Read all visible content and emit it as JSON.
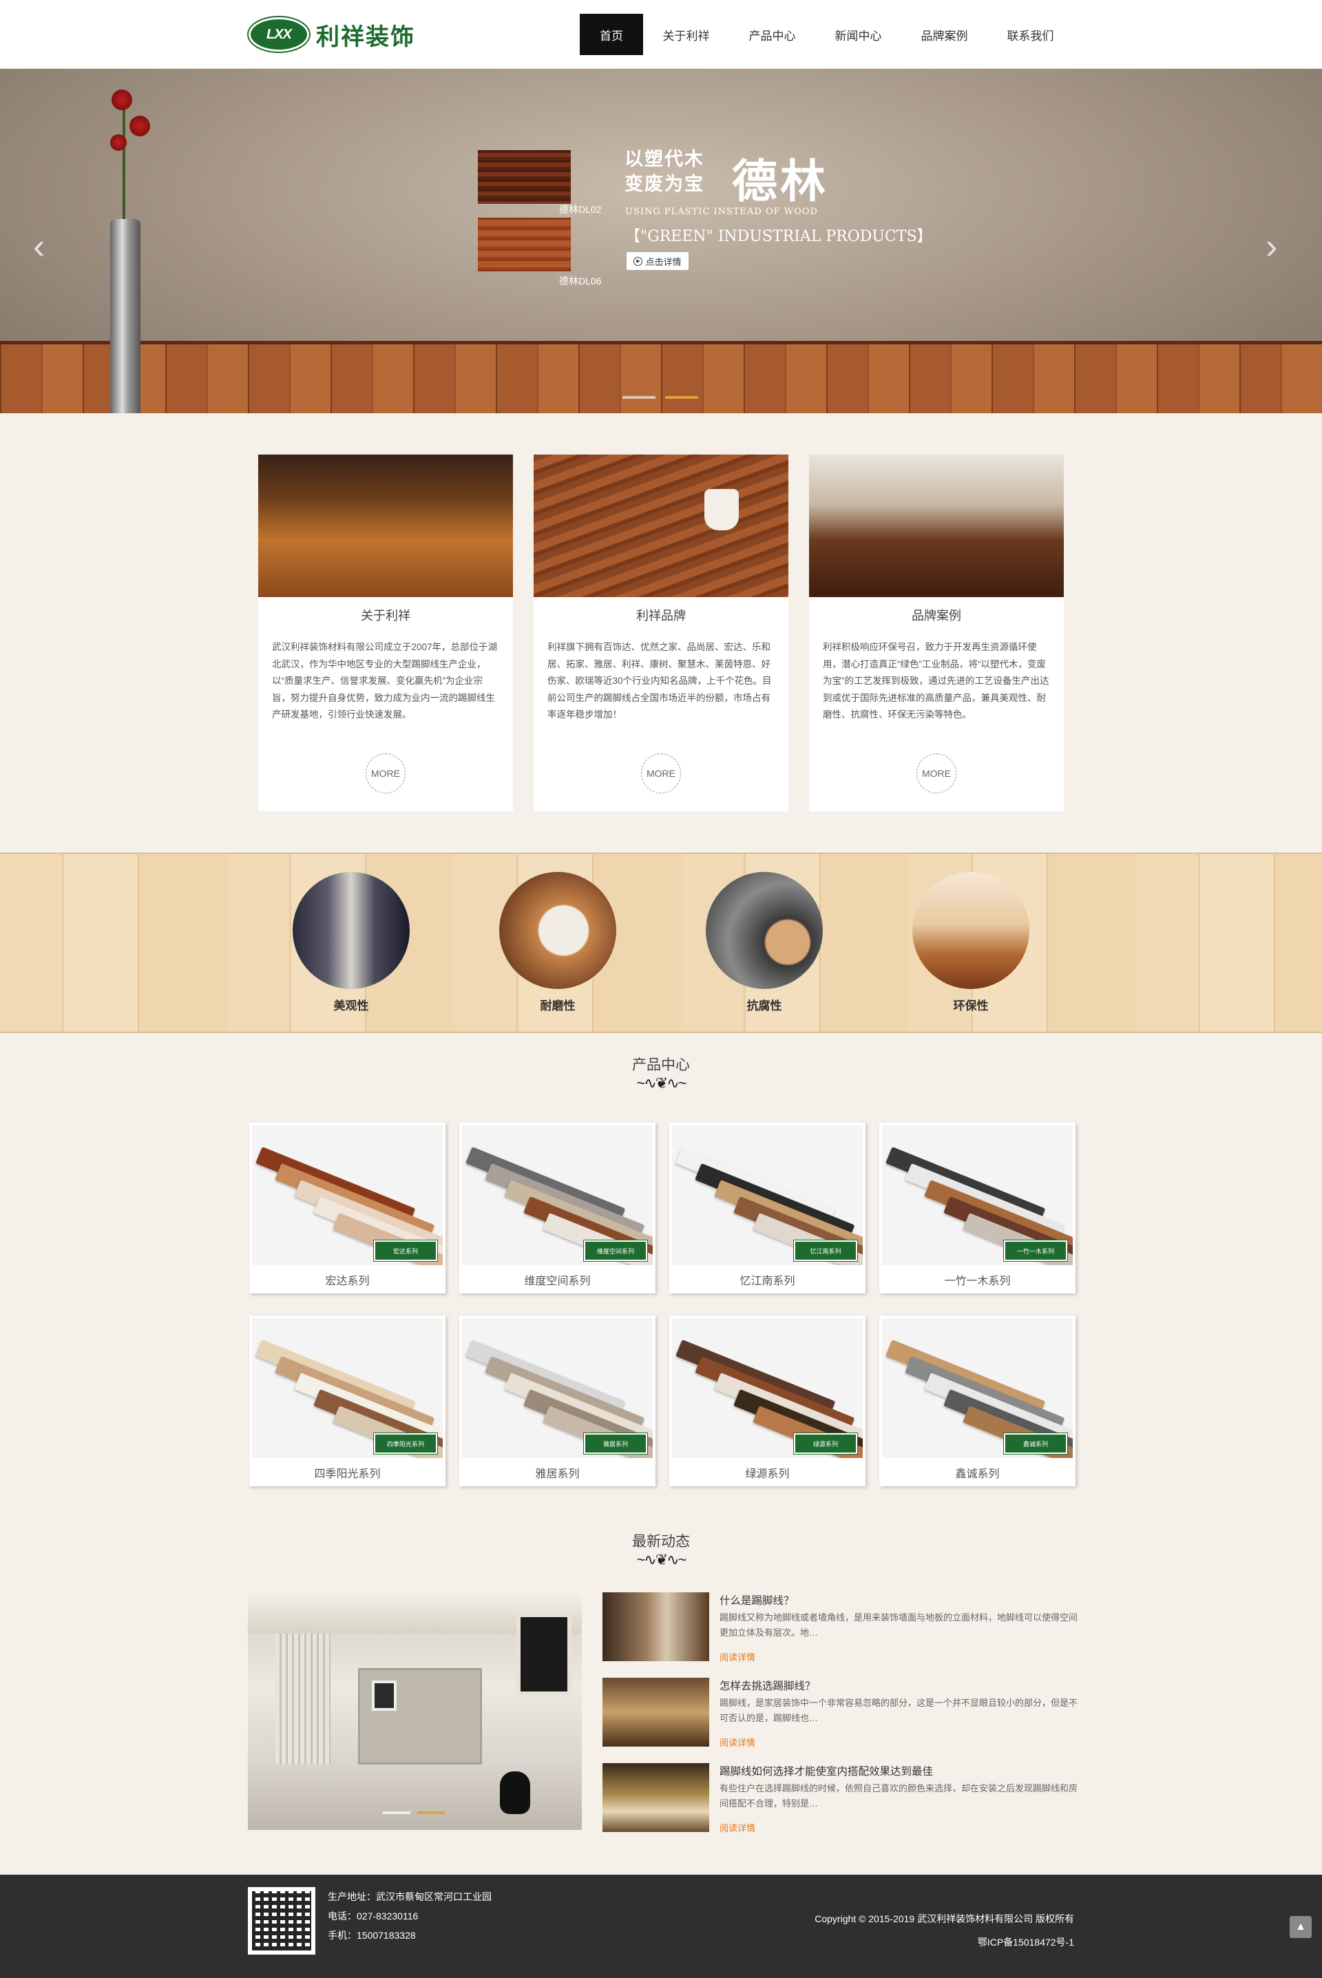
{
  "header": {
    "logo_mark": "LXX",
    "logo_text": "利祥装饰",
    "nav": [
      {
        "label": "首页",
        "active": true
      },
      {
        "label": "关于利祥"
      },
      {
        "label": "产品中心"
      },
      {
        "label": "新闻中心"
      },
      {
        "label": "品牌案例"
      },
      {
        "label": "联系我们"
      }
    ]
  },
  "banner": {
    "slogan_line1": "以塑代木",
    "slogan_line2": "变废为宝",
    "brand": "德林",
    "tagline_en": "USING PLASTIC INSTEAD OF WOOD",
    "subtitle_en": "【\"GREEN\" INDUSTRIAL PRODUCTS】",
    "button_label": "点击详情",
    "product_labels": [
      "德林DL02",
      "德林DL06"
    ],
    "slide_count": 2,
    "active_slide": 2,
    "prev_icon": "chevron-left-icon",
    "next_icon": "chevron-right-icon"
  },
  "intro_cards": [
    {
      "title": "关于利祥",
      "text": "武汉利祥装饰材料有限公司成立于2007年，总部位于湖北武汉，作为华中地区专业的大型踢脚线生产企业，以“质量求生产、信誉求发展、变化赢先机”为企业宗旨，努力提升自身优势，致力成为业内一流的踢脚线生产研发基地，引领行业快速发展。",
      "more": "MORE"
    },
    {
      "title": "利祥品牌",
      "text": "利祥旗下拥有百饰达、优然之家、品尚居、宏达、乐和居、拓家、雅居、利祥、康树、聚慧木、莱茵特恩、好伤家、欧瑞等近30个行业内知名品牌，上千个花色。目前公司生产的踢脚线占全国市场近半的份额，市场占有率逐年稳步增加！",
      "more": "MORE"
    },
    {
      "title": "品牌案例",
      "text": "利祥积极响应环保号召，致力于开发再生资源循环使用，潜心打造真正“绿色”工业制品，将“以塑代木，变废为宝”的工艺发挥到极致，通过先进的工艺设备生产出达到或优于国际先进标准的高质量产品，兼具美观性、耐磨性、抗腐性、环保无污染等特色。",
      "more": "MORE"
    }
  ],
  "features": [
    {
      "label": "美观性"
    },
    {
      "label": "耐磨性"
    },
    {
      "label": "抗腐性"
    },
    {
      "label": "环保性"
    }
  ],
  "products_section": {
    "title": "产品中心",
    "items": [
      {
        "name": "宏达系列",
        "badge": "宏达系列"
      },
      {
        "name": "维度空间系列",
        "badge": "维度空间系列"
      },
      {
        "name": "忆江南系列",
        "badge": "忆江南系列"
      },
      {
        "name": "一竹一木系列",
        "badge": "一竹一木系列"
      },
      {
        "name": "四季阳光系列",
        "badge": "四季阳光系列"
      },
      {
        "name": "雅居系列",
        "badge": "雅居系列"
      },
      {
        "name": "绿源系列",
        "badge": "绿源系列"
      },
      {
        "name": "鑫诚系列",
        "badge": "鑫诚系列"
      }
    ]
  },
  "news_section": {
    "title": "最新动态",
    "slide_count": 2,
    "active_slide": 2,
    "items": [
      {
        "title": "什么是踢脚线？",
        "summary": "踢脚线又称为地脚线或者墙角线，是用来装饰墙面与地板的立面材料，地脚线可以使得空间更加立体及有层次。地…",
        "read_more": "阅读详情"
      },
      {
        "title": "怎样去挑选踢脚线？",
        "summary": "踢脚线，是家居装饰中一个非常容易忽略的部分，这是一个并不显眼且较小的部分，但是不可否认的是，踢脚线也…",
        "read_more": "阅读详情"
      },
      {
        "title": "踢脚线如何选择才能使室内搭配效果达到最佳",
        "summary": "有些住户在选择踢脚线的时候，依照自己喜欢的颜色来选择，却在安装之后发现踢脚线和房间搭配不合理，特别是…",
        "read_more": "阅读详情"
      }
    ]
  },
  "footer": {
    "address": "生产地址：武汉市蔡甸区常河口工业园",
    "phone": "电话：027-83230116",
    "mobile": "手机：15007183328",
    "copyright": "Copyright © 2015-2019 武汉利祥装饰材料有限公司 版权所有",
    "icp": "鄂ICP备15018472号-1",
    "back_to_top_icon": "arrow-up-icon"
  }
}
